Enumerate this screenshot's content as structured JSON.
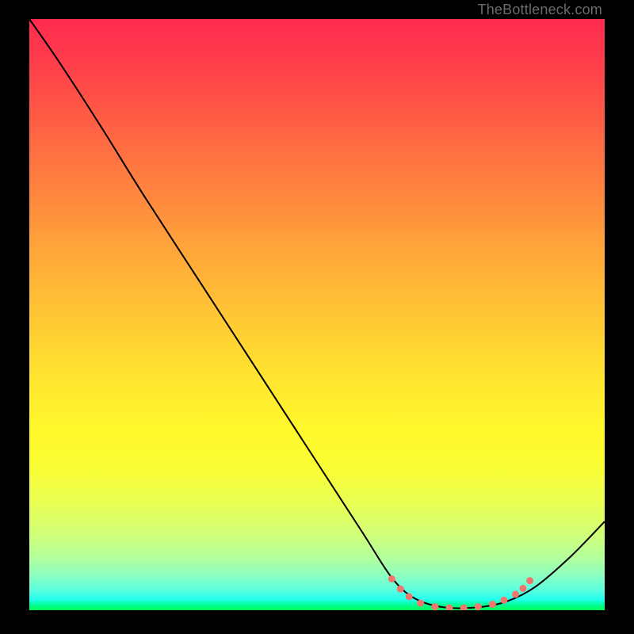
{
  "watermark": "TheBottleneck.com",
  "chart_data": {
    "type": "line",
    "title": "",
    "xlabel": "",
    "ylabel": "",
    "xlim": [
      0,
      100
    ],
    "ylim": [
      0,
      100
    ],
    "series": [
      {
        "name": "curve",
        "color": "#000000",
        "points": [
          {
            "x": 0.0,
            "y": 100.0
          },
          {
            "x": 5.0,
            "y": 93.0
          },
          {
            "x": 12.0,
            "y": 82.5
          },
          {
            "x": 20.0,
            "y": 70.0
          },
          {
            "x": 30.0,
            "y": 55.0
          },
          {
            "x": 40.0,
            "y": 40.0
          },
          {
            "x": 50.0,
            "y": 25.0
          },
          {
            "x": 58.0,
            "y": 13.0
          },
          {
            "x": 63.0,
            "y": 5.5
          },
          {
            "x": 67.0,
            "y": 2.0
          },
          {
            "x": 72.0,
            "y": 0.5
          },
          {
            "x": 78.0,
            "y": 0.5
          },
          {
            "x": 83.0,
            "y": 1.5
          },
          {
            "x": 88.0,
            "y": 4.0
          },
          {
            "x": 94.0,
            "y": 9.0
          },
          {
            "x": 100.0,
            "y": 15.0
          }
        ]
      },
      {
        "name": "floor-markers",
        "color": "#f2766e",
        "points": [
          {
            "x": 63.0,
            "y": 5.3
          },
          {
            "x": 64.5,
            "y": 3.6
          },
          {
            "x": 66.0,
            "y": 2.3
          },
          {
            "x": 68.0,
            "y": 1.2
          },
          {
            "x": 70.5,
            "y": 0.6
          },
          {
            "x": 73.0,
            "y": 0.4
          },
          {
            "x": 75.5,
            "y": 0.4
          },
          {
            "x": 78.0,
            "y": 0.6
          },
          {
            "x": 80.5,
            "y": 1.0
          },
          {
            "x": 82.5,
            "y": 1.7
          },
          {
            "x": 84.5,
            "y": 2.7
          },
          {
            "x": 85.8,
            "y": 3.7
          },
          {
            "x": 87.0,
            "y": 5.0
          }
        ]
      }
    ],
    "gradient": {
      "stops": [
        {
          "pos": 0,
          "color": "#ff2b4e"
        },
        {
          "pos": 100,
          "color": "#00ff55"
        }
      ]
    }
  }
}
